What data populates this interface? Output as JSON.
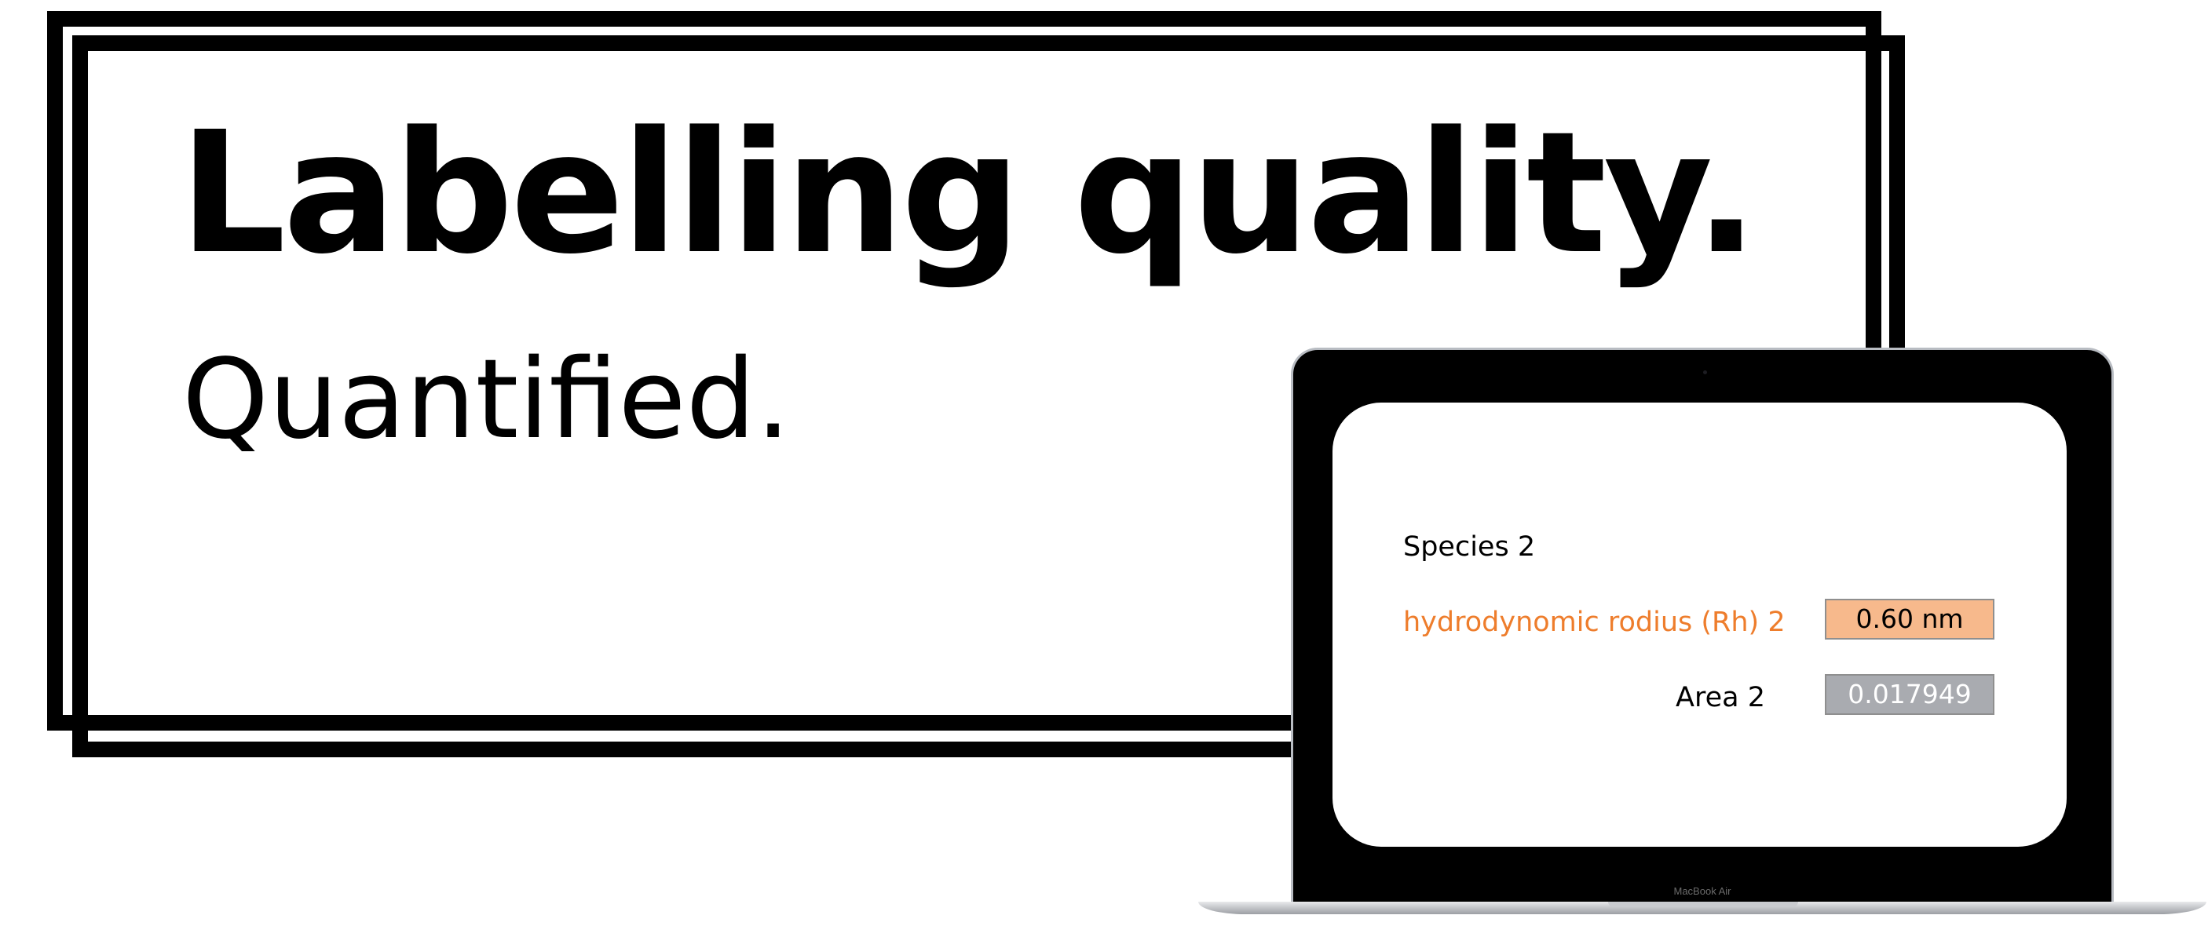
{
  "headline": "Labelling quality.",
  "subline": "Quantified.",
  "laptop": {
    "brand": "MacBook Air"
  },
  "screen": {
    "species_label": "Species 2",
    "rh_label": "hydrodynomic rodius (Rh) 2",
    "rh_value": "0.60 nm",
    "area_label": "Area 2",
    "area_value": "0.017949"
  },
  "colors": {
    "accent_orange": "#ee7d2c",
    "rh_value_bg": "#f7b98c",
    "area_value_bg": "#a9abb0",
    "frame": "#000000"
  }
}
